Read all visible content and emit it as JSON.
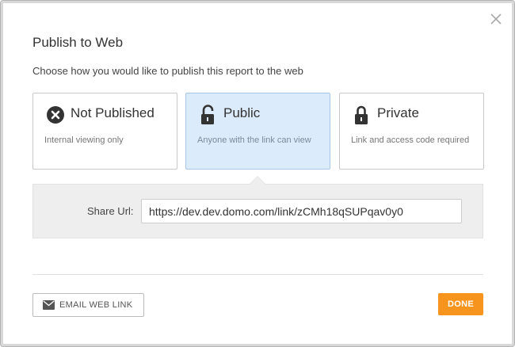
{
  "dialog": {
    "title": "Publish to Web",
    "subtitle": "Choose how you would like to publish this report to the web"
  },
  "options": [
    {
      "label": "Not Published",
      "description": "Internal viewing only",
      "icon": "x-circle-icon",
      "selected": false
    },
    {
      "label": "Public",
      "description": "Anyone with the link can view",
      "icon": "unlocked-padlock-icon",
      "selected": true
    },
    {
      "label": "Private",
      "description": "Link and access code required",
      "icon": "locked-padlock-icon",
      "selected": false
    }
  ],
  "share": {
    "label": "Share Url:",
    "url": "https://dev.dev.domo.com/link/zCMh18qSUPqav0y0"
  },
  "footer": {
    "email_label": "EMAIL WEB LINK",
    "done_label": "DONE"
  },
  "colors": {
    "accent": "#f7941d",
    "selected_bg": "#dcebfb",
    "panel_bg": "#eeeeee"
  }
}
